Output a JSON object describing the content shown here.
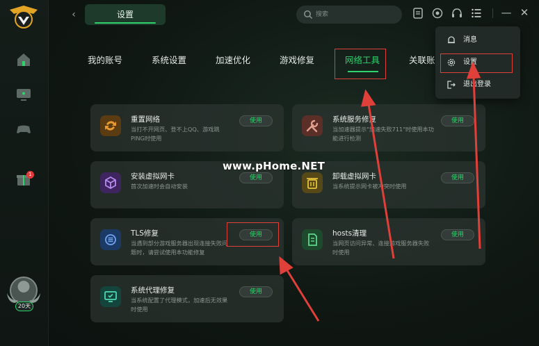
{
  "header": {
    "settings_tab": "设置",
    "search_placeholder": "搜索"
  },
  "sidebar": {
    "notif_count": "1",
    "level_badge": "20天",
    "icons": [
      "home-icon",
      "monitor-icon",
      "gamepad-icon",
      "gift-icon"
    ]
  },
  "nav": {
    "tabs": [
      "我的账号",
      "系统设置",
      "加速优化",
      "游戏修复",
      "网络工具",
      "关联账"
    ],
    "active_index": 4
  },
  "cards": [
    {
      "title": "重置网络",
      "desc": "当打不开网页、登不上QQ、游戏跳PING时使用",
      "button": "使用",
      "icon": "refresh-icon",
      "color": "#d98b2b"
    },
    {
      "title": "系统服务修复",
      "desc": "当加速器提示\"加速失败711\"时使用本功能进行检测",
      "button": "使用",
      "icon": "wrench-icon",
      "color": "#c4674f"
    },
    {
      "title": "安装虚拟网卡",
      "desc": "首次加速时会自动安装",
      "button": "使用",
      "icon": "cube-icon",
      "color": "#8d4fd0"
    },
    {
      "title": "卸载虚拟网卡",
      "desc": "当系统提示网卡被冲突时使用",
      "button": "使用",
      "icon": "trash-icon",
      "color": "#c9a21e"
    },
    {
      "title": "TLS修复",
      "desc": "当遇到部分游戏服务器出现连接失败问题时，请尝试使用本功能修复",
      "button": "使用",
      "icon": "tls-icon",
      "color": "#2e6fd8"
    },
    {
      "title": "hosts清理",
      "desc": "当网页访问异常、连接游戏服务器失败时使用",
      "button": "使用",
      "icon": "file-icon",
      "color": "#2fae5a"
    },
    {
      "title": "系统代理修复",
      "desc": "当系统配置了代理模式，加速后无效果时使用",
      "button": "使用",
      "icon": "monitor-fix-icon",
      "color": "#1fa587"
    }
  ],
  "dropdown": {
    "items": [
      {
        "label": "消息",
        "icon": "bell-icon"
      },
      {
        "label": "设置",
        "icon": "gear-icon"
      },
      {
        "label": "退出登录",
        "icon": "logout-icon"
      }
    ]
  },
  "watermark": "www.pHome.NET",
  "colors": {
    "accent": "#2fd26b",
    "annotation": "#e0403a"
  }
}
